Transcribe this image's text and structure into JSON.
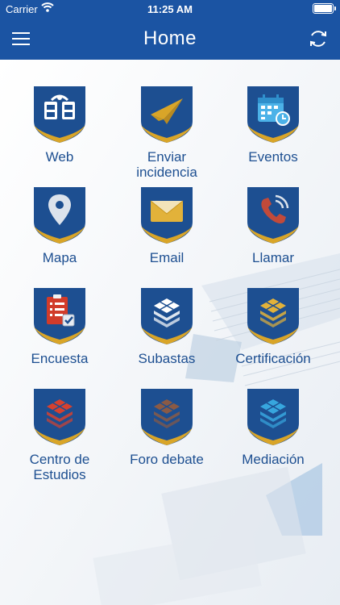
{
  "status_bar": {
    "carrier": "Carrier",
    "time": "11:25 AM"
  },
  "header": {
    "title": "Home",
    "menu_icon": "hamburger-menu-icon",
    "refresh_icon": "refresh-icon"
  },
  "tiles": [
    {
      "label": "Web",
      "icon": "coat-of-arms-icon"
    },
    {
      "label": "Enviar\nincidencia",
      "icon": "paper-plane-icon"
    },
    {
      "label": "Eventos",
      "icon": "calendar-clock-icon"
    },
    {
      "label": "Mapa",
      "icon": "map-pin-icon"
    },
    {
      "label": "Email",
      "icon": "envelope-icon"
    },
    {
      "label": "Llamar",
      "icon": "phone-icon"
    },
    {
      "label": "Encuesta",
      "icon": "survey-checklist-icon"
    },
    {
      "label": "Subastas",
      "icon": "stacked-layers-icon"
    },
    {
      "label": "Certificación",
      "icon": "stacked-layers-icon"
    },
    {
      "label": "Centro de\nEstudios",
      "icon": "stacked-layers-icon"
    },
    {
      "label": "Foro debate",
      "icon": "stacked-layers-icon"
    },
    {
      "label": "Mediación",
      "icon": "stacked-layers-icon"
    }
  ],
  "colors": {
    "header_bg": "#1b54a3",
    "badge_blue": "#1d4f91",
    "badge_gold": "#d9a528",
    "label_text": "#1d4f91",
    "subastas_layers": "#ffffff",
    "certificacion_layers": "#e2b23a",
    "centro_layers": "#d6412f",
    "foro_layers": "#8a5a45",
    "mediacion_layers": "#37a6de",
    "encuesta_red": "#d13b2a"
  }
}
